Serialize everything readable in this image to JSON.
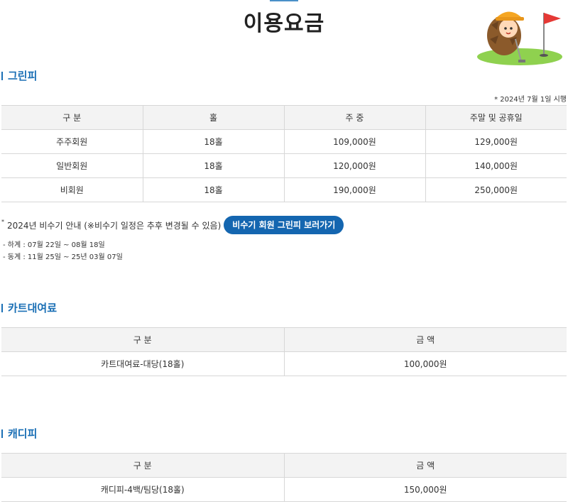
{
  "page": {
    "title": "이용요금"
  },
  "sections": {
    "greenfee": {
      "title": "그린피"
    },
    "cart": {
      "title": "카트대여료"
    },
    "caddie": {
      "title": "캐디피"
    }
  },
  "greenfee_table": {
    "effective_note": "* 2024년 7월 1일 시행",
    "headers": [
      "구 분",
      "홀",
      "주 중",
      "주말 및 공휴일"
    ],
    "rows": [
      [
        "주주회원",
        "18홀",
        "109,000원",
        "129,000원"
      ],
      [
        "일반회원",
        "18홀",
        "120,000원",
        "140,000원"
      ],
      [
        "비회원",
        "18홀",
        "190,000원",
        "250,000원"
      ]
    ]
  },
  "offseason": {
    "star": "*",
    "notice": "2024년 비수기 안내 (※비수기 일정은 추후 변경될 수 있음)",
    "button_label": "비수기 회원 그린피 보러가기",
    "periods": [
      "-   하계 : 07월 22일 ~ 08월 18일",
      "-   동계 : 11월 25일 ~ 25년 03월 07일"
    ]
  },
  "cart_table": {
    "headers": [
      "구 분",
      "금 액"
    ],
    "rows": [
      [
        "카트대여료-대당(18홀)",
        "100,000원"
      ]
    ]
  },
  "caddie_table": {
    "headers": [
      "구 분",
      "금 액"
    ],
    "rows": [
      [
        "캐디피-4백/팀당(18홀)",
        "150,000원"
      ]
    ]
  },
  "colors": {
    "accent": "#1a6fb5",
    "button": "#1466b0",
    "header_bg": "#f3f3f3"
  },
  "icons": {
    "mascot": "pinecone-golfer-mascot-icon",
    "flag": "golf-flag-icon"
  }
}
